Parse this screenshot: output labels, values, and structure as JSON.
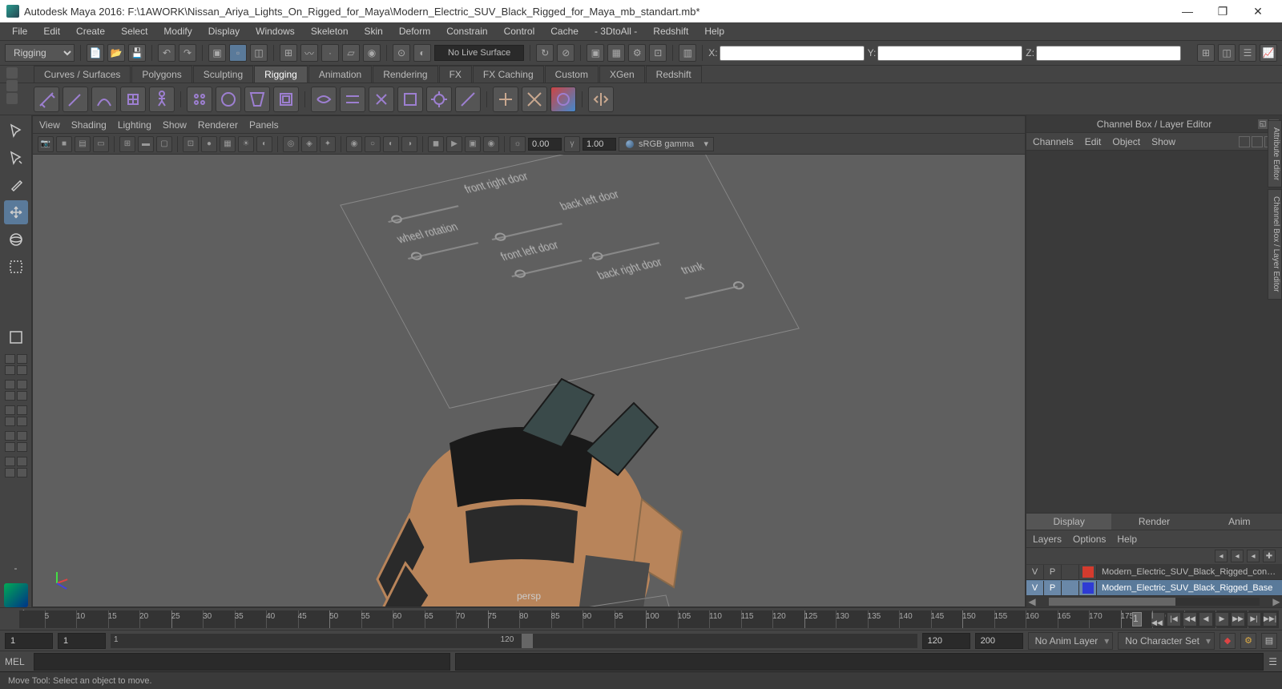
{
  "title": "Autodesk Maya 2016: F:\\1AWORK\\Nissan_Ariya_Lights_On_Rigged_for_Maya\\Modern_Electric_SUV_Black_Rigged_for_Maya_mb_standart.mb*",
  "menu": [
    "File",
    "Edit",
    "Create",
    "Select",
    "Modify",
    "Display",
    "Windows",
    "Skeleton",
    "Skin",
    "Deform",
    "Constrain",
    "Control",
    "Cache",
    "- 3DtoAll -",
    "Redshift",
    "Help"
  ],
  "workspace": "Rigging",
  "livesurface": "No Live Surface",
  "coords": {
    "x": "X:",
    "y": "Y:",
    "z": "Z:"
  },
  "shelfTabs": [
    "Curves / Surfaces",
    "Polygons",
    "Sculpting",
    "Rigging",
    "Animation",
    "Rendering",
    "FX",
    "FX Caching",
    "Custom",
    "XGen",
    "Redshift"
  ],
  "shelfActive": "Rigging",
  "vpMenu": [
    "View",
    "Shading",
    "Lighting",
    "Show",
    "Renderer",
    "Panels"
  ],
  "vpNum1": "0.00",
  "vpNum2": "1.00",
  "vpCombo": "sRGB gamma",
  "perspLabel": "persp",
  "rigLabels": [
    "front right door",
    "wheel rotation",
    "back left door",
    "front left door",
    "back right door",
    "trunk"
  ],
  "channelBox": {
    "title": "Channel Box / Layer Editor",
    "tabs": [
      "Channels",
      "Edit",
      "Object",
      "Show"
    ],
    "split": [
      "Display",
      "Render",
      "Anim"
    ],
    "splitActive": "Display",
    "layersMenu": [
      "Layers",
      "Options",
      "Help"
    ],
    "layers": [
      {
        "v": "V",
        "p": "P",
        "color": "#d43b2e",
        "name": "Modern_Electric_SUV_Black_Rigged_controlle",
        "sel": false
      },
      {
        "v": "V",
        "p": "P",
        "color": "#2e3bd4",
        "name": "Modern_Electric_SUV_Black_Rigged_Base",
        "sel": true
      }
    ]
  },
  "sideTabs": [
    "Attribute Editor",
    "Channel Box / Layer Editor"
  ],
  "timeline": {
    "cur": "1",
    "handle": "1"
  },
  "range": {
    "start": "1",
    "startIn": "1",
    "sliderStart": "1",
    "sliderEnd": "120",
    "end": "120",
    "endOut": "200",
    "animLayer": "No Anim Layer",
    "charSet": "No Character Set"
  },
  "cmd": {
    "lang": "MEL"
  },
  "status": "Move Tool: Select an object to move.",
  "playIcons": [
    "|◀◀",
    "|◀",
    "◀◀",
    "◀",
    "▶",
    "▶▶",
    "▶|",
    "▶▶|"
  ]
}
